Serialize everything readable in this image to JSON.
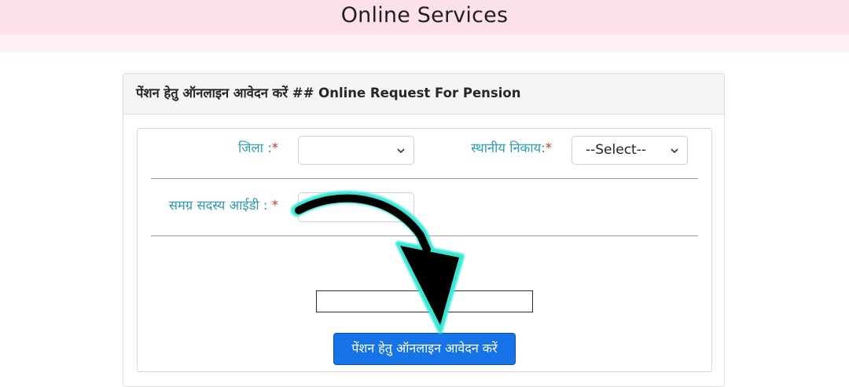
{
  "header": {
    "title": "Online Services"
  },
  "form": {
    "heading": "पेंशन हेतु ऑनलाइन आवेदन करें ## Online Request For Pension",
    "district": {
      "label": "जिला :",
      "required_mark": "*",
      "selected": ""
    },
    "local_body": {
      "label": "स्थानीय निकाय:",
      "required_mark": "*",
      "selected": "--Select--"
    },
    "samagra_id": {
      "label": "समग्र सदस्य आईडी : ",
      "required_mark": "*",
      "value": ""
    },
    "captcha_input": {
      "value": ""
    },
    "submit_label": "पेंशन हेतु ऑनलाइन आवेदन करें"
  },
  "annotation": {
    "arrow_icon": "curved-arrow-icon",
    "arrow_color": "#000000",
    "arrow_glow": "#39e6d6"
  },
  "colors": {
    "header_band": "#fce0ec",
    "label_color": "#2a9bb5",
    "required_color": "#c0392b",
    "button": "#1673e8"
  }
}
